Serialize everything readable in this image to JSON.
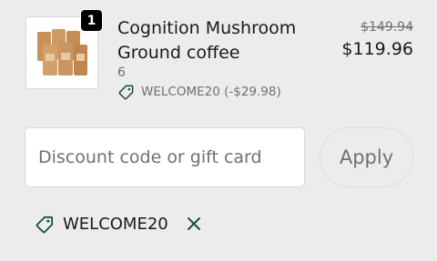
{
  "line_item": {
    "quantity": "1",
    "name": "Cognition Mushroom Ground coffee",
    "variant": "6",
    "discount_text": "WELCOME20 (-$29.98)",
    "price_compare": "$149.94",
    "price_final": "$119.96",
    "image_icon": "coffee-bags-image"
  },
  "discount_form": {
    "placeholder": "Discount code or gift card",
    "apply_label": "Apply"
  },
  "applied_discount": {
    "code": "WELCOME20",
    "tag_icon": "tag-icon",
    "remove_icon": "close-icon"
  },
  "colors": {
    "background": "#ececec",
    "accent": "#1b4d4b",
    "muted_text": "#707070"
  }
}
